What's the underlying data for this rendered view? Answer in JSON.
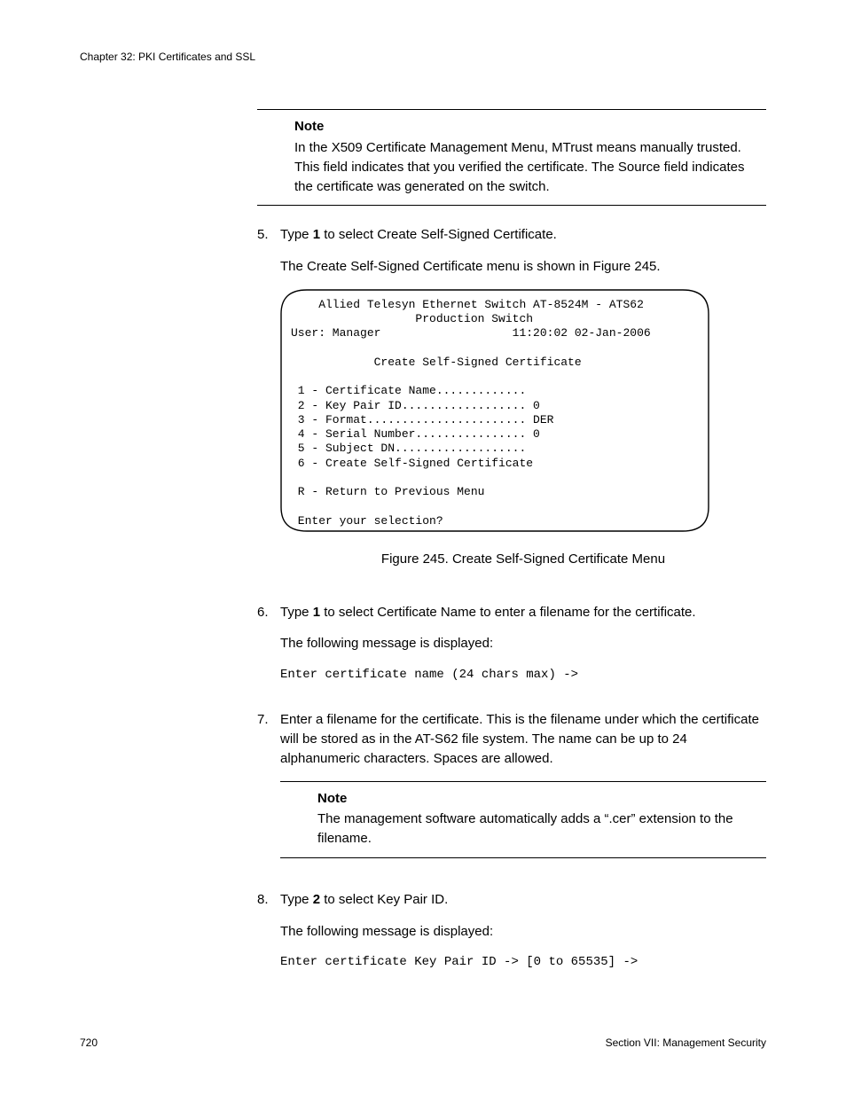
{
  "header": {
    "chapter": "Chapter 32: PKI Certificates and SSL"
  },
  "note1": {
    "title": "Note",
    "body": "In the X509 Certificate Management Menu, MTrust means manually trusted. This field indicates that you verified the certificate. The Source field indicates the certificate was generated on the switch."
  },
  "step5": {
    "num": "5.",
    "line1_a": "Type ",
    "line1_b": "1",
    "line1_c": " to select Create Self-Signed Certificate.",
    "line2": "The Create Self-Signed Certificate menu is shown in Figure 245."
  },
  "terminal": {
    "text": "    Allied Telesyn Ethernet Switch AT-8524M - ATS62\n                  Production Switch\nUser: Manager                   11:20:02 02-Jan-2006\n\n            Create Self-Signed Certificate\n\n 1 - Certificate Name.............\n 2 - Key Pair ID.................. 0\n 3 - Format....................... DER\n 4 - Serial Number................ 0\n 5 - Subject DN...................\n 6 - Create Self-Signed Certificate\n\n R - Return to Previous Menu\n\n Enter your selection?"
  },
  "figure": {
    "caption": "Figure 245. Create Self-Signed Certificate Menu"
  },
  "step6": {
    "num": "6.",
    "line1_a": "Type ",
    "line1_b": "1",
    "line1_c": " to select Certificate Name to enter a filename for the certificate.",
    "line2": "The following message is displayed:",
    "mono": "Enter certificate name (24 chars max) ->"
  },
  "step7": {
    "num": "7.",
    "body": "Enter a filename for the certificate. This is the filename under which the certificate will be stored as in the AT-S62 file system. The name can be up to 24 alphanumeric characters. Spaces are allowed."
  },
  "note2": {
    "title": "Note",
    "body": "The management software automatically adds a “.cer” extension to the filename."
  },
  "step8": {
    "num": "8.",
    "line1_a": "Type ",
    "line1_b": "2",
    "line1_c": " to select Key Pair ID.",
    "line2": "The following message is displayed:",
    "mono": "Enter certificate Key Pair ID -> [0 to 65535] ->"
  },
  "footer": {
    "page": "720",
    "section": "Section VII: Management Security"
  }
}
